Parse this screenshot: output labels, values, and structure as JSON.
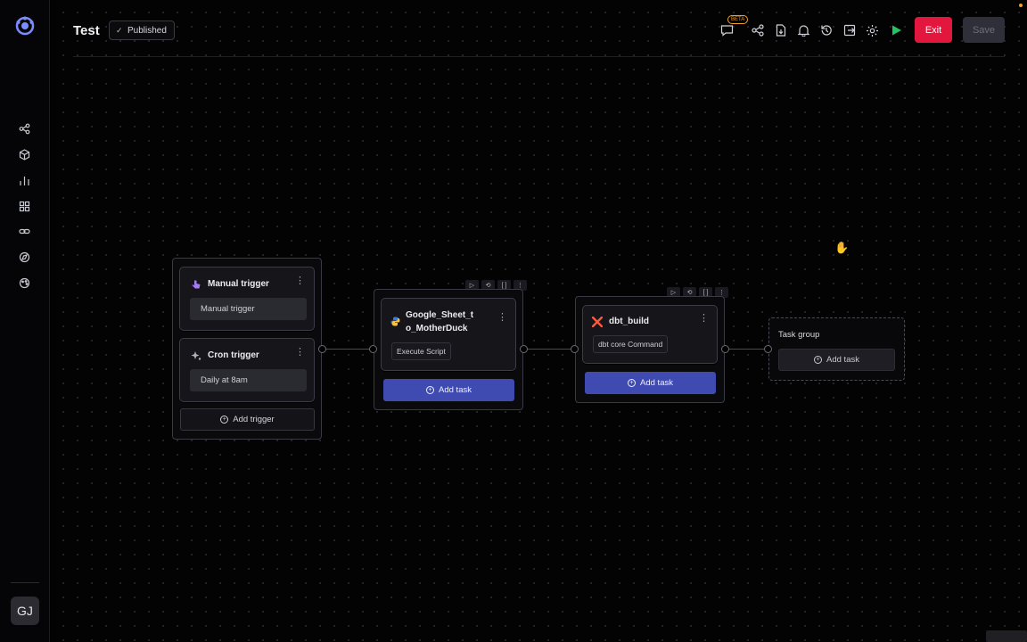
{
  "app": {
    "title": "Test",
    "status_badge": "Published"
  },
  "header": {
    "beta_label": "BETA",
    "exit_label": "Exit",
    "save_label": "Save",
    "icons": [
      "chat-icon",
      "share-graph-icon",
      "document-icon",
      "bell-icon",
      "history-icon",
      "export-icon",
      "settings-icon",
      "run-icon"
    ],
    "colors": {
      "exit": "#e3173e",
      "run": "#22c55e",
      "save_disabled": "#2e2f38"
    }
  },
  "sidebar": {
    "icons": [
      "graph-icon",
      "cube-icon",
      "bar-chart-icon",
      "grid-icon",
      "link-icon",
      "compass-icon",
      "palette-icon"
    ],
    "avatar_initials": "GJ"
  },
  "triggers": {
    "manual": {
      "title": "Manual trigger",
      "chip": "Manual trigger"
    },
    "cron": {
      "title": "Cron trigger",
      "chip": "Daily at 8am"
    },
    "add_label": "Add trigger"
  },
  "tasks": [
    {
      "title_line1": "Google_Sheet_t",
      "title_line2": "o_MotherDuck",
      "chip": "Execute Script",
      "add_label": "Add task"
    },
    {
      "title": "dbt_build",
      "chip": "dbt core Command",
      "add_label": "Add task"
    }
  ],
  "task_group": {
    "title": "Task group",
    "add_label": "Add task"
  }
}
